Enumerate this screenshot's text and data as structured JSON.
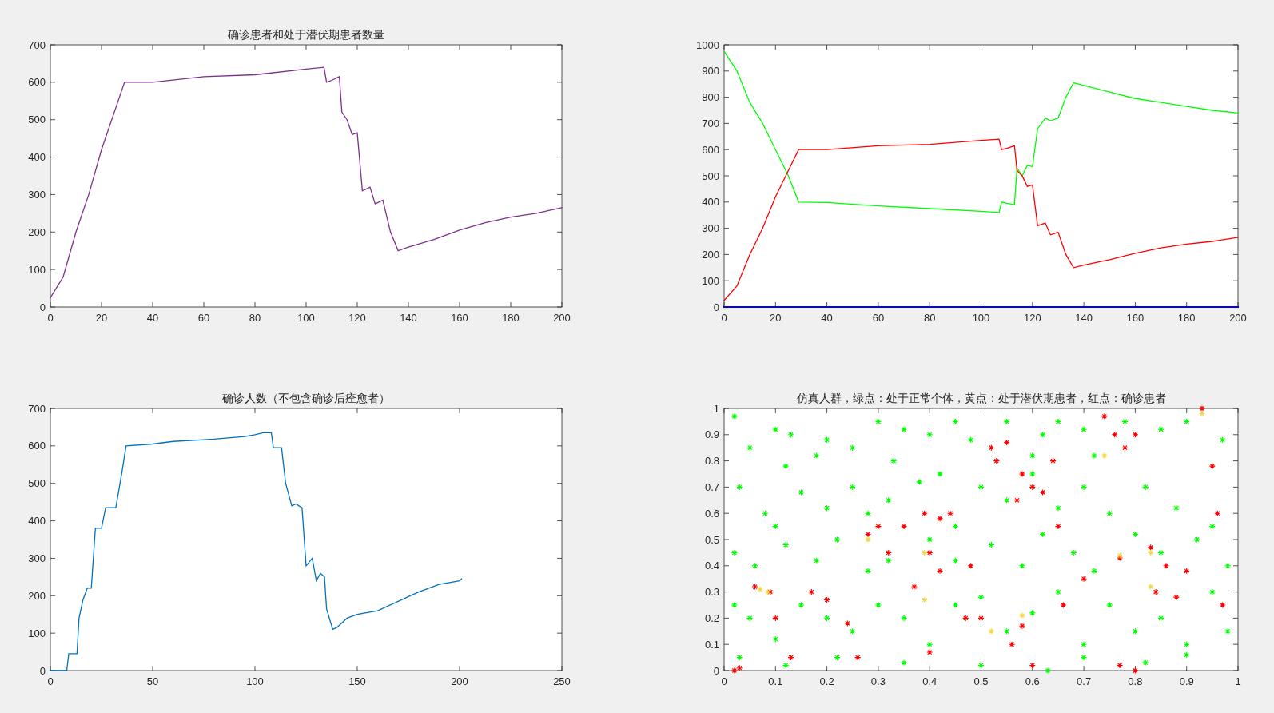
{
  "figures": [
    {
      "chart_data": {
        "type": "line",
        "title": "确诊患者和处于潜伏期患者数量",
        "x": [
          0,
          5,
          10,
          15,
          20,
          25,
          29,
          40,
          60,
          80,
          100,
          107,
          108,
          110,
          113,
          114,
          116,
          118,
          120,
          122,
          125,
          127,
          130,
          133,
          136,
          140,
          150,
          160,
          170,
          180,
          190,
          200
        ],
        "series": [
          {
            "color": "#7e2f8e",
            "values": [
              25,
              80,
              200,
              300,
              420,
              520,
              600,
              600,
              615,
              620,
              635,
              640,
              600,
              605,
              615,
              520,
              500,
              460,
              465,
              310,
              320,
              275,
              285,
              200,
              150,
              160,
              180,
              205,
              225,
              240,
              250,
              265
            ]
          }
        ],
        "xlim": [
          0,
          200
        ],
        "ylim": [
          0,
          700
        ],
        "xticks": [
          {
            "value": 0,
            "label": "0"
          },
          {
            "value": 20,
            "label": "20"
          },
          {
            "value": 40,
            "label": "40"
          },
          {
            "value": 60,
            "label": "60"
          },
          {
            "value": 80,
            "label": "80"
          },
          {
            "value": 100,
            "label": "100"
          },
          {
            "value": 120,
            "label": "120"
          },
          {
            "value": 140,
            "label": "140"
          },
          {
            "value": 160,
            "label": "160"
          },
          {
            "value": 180,
            "label": "180"
          },
          {
            "value": 200,
            "label": "200"
          }
        ],
        "yticks": [
          {
            "value": 0,
            "label": "0"
          },
          {
            "value": 100,
            "label": "100"
          },
          {
            "value": 200,
            "label": "200"
          },
          {
            "value": 300,
            "label": "300"
          },
          {
            "value": 400,
            "label": "400"
          },
          {
            "value": 500,
            "label": "500"
          },
          {
            "value": 600,
            "label": "600"
          },
          {
            "value": 700,
            "label": "700"
          }
        ]
      }
    },
    {
      "chart_data": {
        "type": "line",
        "x": [
          0,
          5,
          10,
          15,
          20,
          25,
          29,
          40,
          60,
          80,
          100,
          107,
          108,
          110,
          113,
          114,
          116,
          118,
          120,
          122,
          125,
          127,
          130,
          133,
          136,
          140,
          150,
          160,
          170,
          180,
          190,
          200
        ],
        "series": [
          {
            "color": "#00ff00",
            "values": [
              975,
              900,
              780,
              700,
              600,
              500,
              400,
              398,
              385,
              375,
              365,
              360,
              400,
              395,
              390,
              530,
              500,
              540,
              535,
              680,
              720,
              710,
              720,
              800,
              855,
              845,
              820,
              795,
              780,
              765,
              750,
              740
            ]
          },
          {
            "color": "#ff0000",
            "values": [
              25,
              80,
              200,
              300,
              420,
              520,
              600,
              600,
              615,
              620,
              635,
              640,
              600,
              605,
              615,
              520,
              500,
              460,
              465,
              310,
              320,
              275,
              285,
              200,
              150,
              160,
              180,
              205,
              225,
              240,
              250,
              265
            ]
          },
          {
            "color": "#0000ff",
            "values": [
              0,
              0,
              0,
              0,
              0,
              0,
              0,
              0,
              0,
              0,
              0,
              0,
              0,
              0,
              0,
              0,
              0,
              0,
              0,
              0,
              0,
              0,
              0,
              0,
              0,
              0,
              0,
              0,
              0,
              0,
              0,
              0
            ]
          }
        ],
        "xlim": [
          0,
          200
        ],
        "ylim": [
          0,
          1000
        ],
        "xticks": [
          {
            "value": 0,
            "label": "0"
          },
          {
            "value": 20,
            "label": "20"
          },
          {
            "value": 40,
            "label": "40"
          },
          {
            "value": 60,
            "label": "60"
          },
          {
            "value": 80,
            "label": "80"
          },
          {
            "value": 100,
            "label": "100"
          },
          {
            "value": 120,
            "label": "120"
          },
          {
            "value": 140,
            "label": "140"
          },
          {
            "value": 160,
            "label": "160"
          },
          {
            "value": 180,
            "label": "180"
          },
          {
            "value": 200,
            "label": "200"
          }
        ],
        "yticks": [
          {
            "value": 0,
            "label": "0"
          },
          {
            "value": 100,
            "label": "100"
          },
          {
            "value": 200,
            "label": "200"
          },
          {
            "value": 300,
            "label": "300"
          },
          {
            "value": 400,
            "label": "400"
          },
          {
            "value": 500,
            "label": "500"
          },
          {
            "value": 600,
            "label": "600"
          },
          {
            "value": 700,
            "label": "700"
          },
          {
            "value": 800,
            "label": "800"
          },
          {
            "value": 900,
            "label": "900"
          },
          {
            "value": 1000,
            "label": "1000"
          }
        ]
      }
    },
    {
      "chart_data": {
        "type": "line",
        "title": "确诊人数（不包含确诊后痊愈者）",
        "x": [
          0,
          8,
          9,
          13,
          14,
          16,
          18,
          20,
          22,
          25,
          27,
          32,
          35,
          37,
          50,
          60,
          80,
          95,
          100,
          104,
          108,
          109,
          113,
          115,
          118,
          120,
          123,
          125,
          128,
          130,
          132,
          134,
          135,
          138,
          140,
          145,
          150,
          160,
          170,
          180,
          190,
          200,
          201
        ],
        "series": [
          {
            "color": "#0072bd",
            "values": [
              0,
              0,
              45,
              45,
              140,
              190,
              220,
              220,
              380,
              380,
              435,
              435,
              530,
              600,
              605,
              612,
              618,
              625,
              630,
              635,
              635,
              595,
              595,
              500,
              440,
              445,
              435,
              280,
              300,
              240,
              260,
              250,
              165,
              110,
              115,
              140,
              150,
              160,
              185,
              210,
              230,
              240,
              245
            ]
          }
        ],
        "xlim": [
          0,
          250
        ],
        "ylim": [
          0,
          700
        ],
        "xticks": [
          {
            "value": 0,
            "label": "0"
          },
          {
            "value": 50,
            "label": "50"
          },
          {
            "value": 100,
            "label": "100"
          },
          {
            "value": 150,
            "label": "150"
          },
          {
            "value": 200,
            "label": "200"
          },
          {
            "value": 250,
            "label": "250"
          }
        ],
        "yticks": [
          {
            "value": 0,
            "label": "0"
          },
          {
            "value": 100,
            "label": "100"
          },
          {
            "value": 200,
            "label": "200"
          },
          {
            "value": 300,
            "label": "300"
          },
          {
            "value": 400,
            "label": "400"
          },
          {
            "value": 500,
            "label": "500"
          },
          {
            "value": 600,
            "label": "600"
          },
          {
            "value": 700,
            "label": "700"
          }
        ]
      }
    },
    {
      "chart_data": {
        "type": "scatter",
        "title": "仿真人群，绿点：处于正常个体，黄点：处于潜伏期患者，红点：确诊患者",
        "series": [
          {
            "color": "#00ff00",
            "x": [
              0.02,
              0.05,
              0.1,
              0.13,
              0.12,
              0.18,
              0.2,
              0.25,
              0.3,
              0.35,
              0.4,
              0.45,
              0.48,
              0.55,
              0.62,
              0.65,
              0.7,
              0.78,
              0.85,
              0.9,
              0.97,
              0.03,
              0.08,
              0.1,
              0.15,
              0.2,
              0.25,
              0.28,
              0.32,
              0.38,
              0.45,
              0.5,
              0.55,
              0.6,
              0.65,
              0.7,
              0.75,
              0.82,
              0.88,
              0.95,
              0.02,
              0.06,
              0.12,
              0.18,
              0.22,
              0.28,
              0.32,
              0.4,
              0.45,
              0.52,
              0.58,
              0.62,
              0.68,
              0.72,
              0.8,
              0.85,
              0.92,
              0.98,
              0.02,
              0.05,
              0.1,
              0.15,
              0.2,
              0.25,
              0.3,
              0.35,
              0.4,
              0.45,
              0.5,
              0.55,
              0.6,
              0.65,
              0.7,
              0.75,
              0.8,
              0.85,
              0.9,
              0.95,
              0.03,
              0.12,
              0.22,
              0.35,
              0.5,
              0.63,
              0.7,
              0.82,
              0.9,
              0.98,
              0.6,
              0.33,
              0.42,
              0.72
            ],
            "values": [
              0.97,
              0.85,
              0.92,
              0.9,
              0.78,
              0.82,
              0.88,
              0.85,
              0.95,
              0.92,
              0.9,
              0.95,
              0.88,
              0.95,
              0.9,
              0.95,
              0.92,
              0.95,
              0.92,
              0.95,
              0.88,
              0.7,
              0.6,
              0.55,
              0.68,
              0.62,
              0.7,
              0.6,
              0.65,
              0.72,
              0.55,
              0.7,
              0.65,
              0.75,
              0.62,
              0.7,
              0.6,
              0.7,
              0.62,
              0.55,
              0.45,
              0.4,
              0.48,
              0.42,
              0.5,
              0.38,
              0.42,
              0.5,
              0.42,
              0.48,
              0.4,
              0.52,
              0.45,
              0.38,
              0.52,
              0.45,
              0.5,
              0.4,
              0.25,
              0.2,
              0.12,
              0.25,
              0.2,
              0.15,
              0.25,
              0.2,
              0.1,
              0.25,
              0.28,
              0.15,
              0.22,
              0.3,
              0.1,
              0.25,
              0.15,
              0.2,
              0.1,
              0.3,
              0.05,
              0.02,
              0.05,
              0.03,
              0.02,
              0.0,
              0.05,
              0.03,
              0.06,
              0.15,
              0.82,
              0.8,
              0.75,
              0.82
            ]
          },
          {
            "color": "#ff0000",
            "x": [
              0.02,
              0.03,
              0.06,
              0.09,
              0.1,
              0.13,
              0.17,
              0.2,
              0.24,
              0.26,
              0.28,
              0.3,
              0.32,
              0.35,
              0.37,
              0.39,
              0.4,
              0.42,
              0.44,
              0.42,
              0.4,
              0.48,
              0.5,
              0.52,
              0.53,
              0.55,
              0.57,
              0.58,
              0.6,
              0.6,
              0.62,
              0.64,
              0.65,
              0.66,
              0.7,
              0.74,
              0.76,
              0.78,
              0.8,
              0.77,
              0.77,
              0.8,
              0.83,
              0.84,
              0.86,
              0.9,
              0.93,
              0.95,
              0.96,
              0.97,
              0.88,
              0.58,
              0.47,
              0.56
            ],
            "values": [
              0.0,
              0.01,
              0.32,
              0.3,
              0.2,
              0.05,
              0.3,
              0.27,
              0.18,
              0.05,
              0.52,
              0.55,
              0.45,
              0.55,
              0.32,
              0.6,
              0.45,
              0.58,
              0.6,
              0.38,
              0.07,
              0.4,
              0.2,
              0.85,
              0.8,
              0.87,
              0.65,
              0.75,
              0.7,
              0.02,
              0.68,
              0.8,
              0.55,
              0.25,
              0.35,
              0.97,
              0.9,
              0.85,
              0.9,
              0.43,
              0.02,
              0.0,
              0.47,
              0.3,
              0.4,
              0.38,
              1.0,
              0.78,
              0.6,
              0.25,
              0.28,
              0.17,
              0.2,
              0.1
            ]
          },
          {
            "color": "#f2d84a",
            "x": [
              0.07,
              0.085,
              0.28,
              0.39,
              0.39,
              0.52,
              0.58,
              0.74,
              0.77,
              0.83,
              0.83,
              0.93
            ],
            "values": [
              0.31,
              0.3,
              0.5,
              0.45,
              0.27,
              0.15,
              0.21,
              0.82,
              0.44,
              0.45,
              0.32,
              0.98
            ]
          }
        ],
        "xlim": [
          0,
          1
        ],
        "ylim": [
          0,
          1
        ],
        "xticks": [
          {
            "value": 0,
            "label": "0"
          },
          {
            "value": 0.1,
            "label": "0.1"
          },
          {
            "value": 0.2,
            "label": "0.2"
          },
          {
            "value": 0.3,
            "label": "0.3"
          },
          {
            "value": 0.4,
            "label": "0.4"
          },
          {
            "value": 0.5,
            "label": "0.5"
          },
          {
            "value": 0.6,
            "label": "0.6"
          },
          {
            "value": 0.7,
            "label": "0.7"
          },
          {
            "value": 0.8,
            "label": "0.8"
          },
          {
            "value": 0.9,
            "label": "0.9"
          },
          {
            "value": 1,
            "label": "1"
          }
        ],
        "yticks": [
          {
            "value": 0,
            "label": "0"
          },
          {
            "value": 0.1,
            "label": "0.1"
          },
          {
            "value": 0.2,
            "label": "0.2"
          },
          {
            "value": 0.3,
            "label": "0.3"
          },
          {
            "value": 0.4,
            "label": "0.4"
          },
          {
            "value": 0.5,
            "label": "0.5"
          },
          {
            "value": 0.6,
            "label": "0.6"
          },
          {
            "value": 0.7,
            "label": "0.7"
          },
          {
            "value": 0.8,
            "label": "0.8"
          },
          {
            "value": 0.9,
            "label": "0.9"
          },
          {
            "value": 1,
            "label": "1"
          }
        ]
      }
    }
  ]
}
